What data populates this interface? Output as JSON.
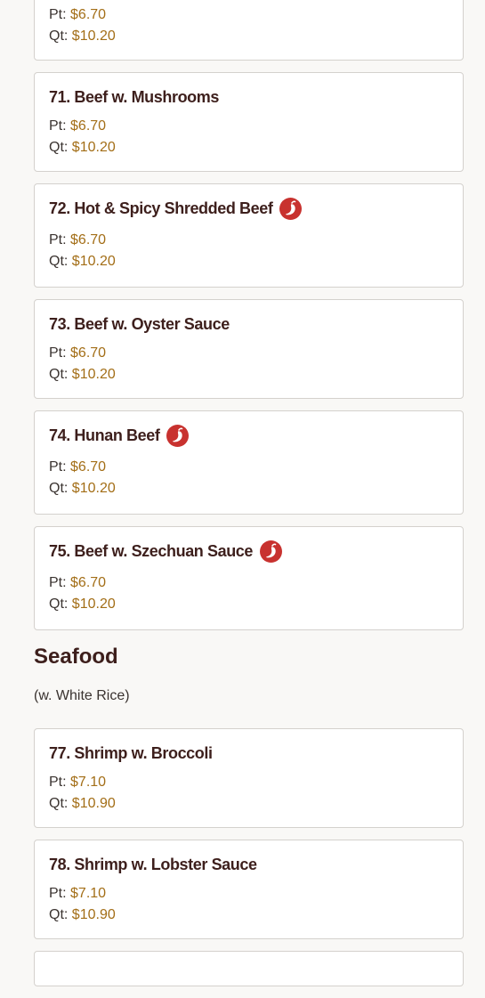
{
  "prices_labels": {
    "pt": "Pt:",
    "qt": "Qt:"
  },
  "top_card": {
    "pt": "$6.70",
    "qt": "$10.20"
  },
  "beef_items": [
    {
      "title": "71. Beef w. Mushrooms",
      "spicy": false,
      "pt": "$6.70",
      "qt": "$10.20"
    },
    {
      "title": "72. Hot & Spicy Shredded Beef",
      "spicy": true,
      "pt": "$6.70",
      "qt": "$10.20"
    },
    {
      "title": "73. Beef w. Oyster Sauce",
      "spicy": false,
      "pt": "$6.70",
      "qt": "$10.20"
    },
    {
      "title": "74. Hunan Beef",
      "spicy": true,
      "pt": "$6.70",
      "qt": "$10.20"
    },
    {
      "title": "75. Beef w. Szechuan Sauce",
      "spicy": true,
      "pt": "$6.70",
      "qt": "$10.20"
    }
  ],
  "seafood": {
    "heading": "Seafood",
    "subtitle": "(w. White Rice)",
    "items": [
      {
        "title": "77. Shrimp w. Broccoli",
        "spicy": false,
        "pt": "$7.10",
        "qt": "$10.90"
      },
      {
        "title": "78. Shrimp w. Lobster Sauce",
        "spicy": false,
        "pt": "$7.10",
        "qt": "$10.90"
      }
    ]
  },
  "colors": {
    "spicy_badge": "#c8322f",
    "price_amount": "#a36e17",
    "title": "#3d1f1c"
  }
}
